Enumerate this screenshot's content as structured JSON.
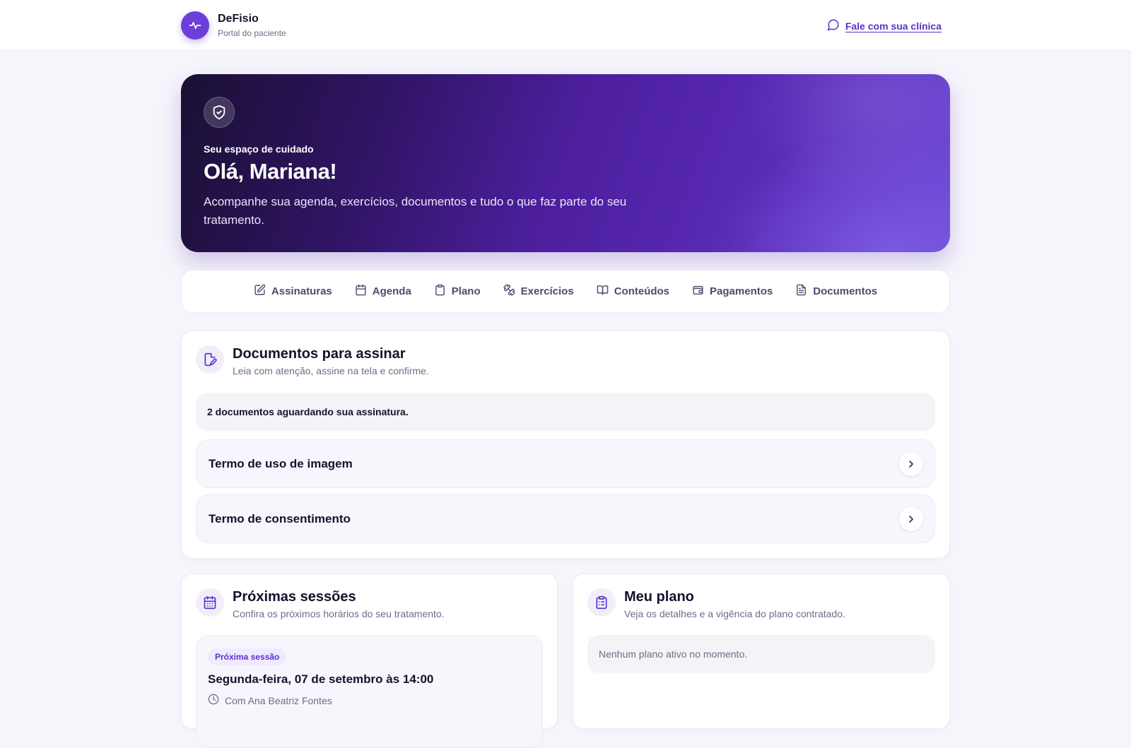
{
  "header": {
    "brand_name": "DeFisio",
    "brand_sub": "Portal do paciente",
    "contact_label": "Fale com sua clínica"
  },
  "hero": {
    "eyebrow": "Seu espaço de cuidado",
    "title": "Olá, Mariana!",
    "description": "Acompanhe sua agenda, exercícios, documentos e tudo o que faz parte do seu tratamento."
  },
  "tabs": [
    {
      "label": "Assinaturas",
      "icon": "signature-icon"
    },
    {
      "label": "Agenda",
      "icon": "calendar-icon"
    },
    {
      "label": "Plano",
      "icon": "clipboard-icon"
    },
    {
      "label": "Exercícios",
      "icon": "dumbbell-icon"
    },
    {
      "label": "Conteúdos",
      "icon": "book-icon"
    },
    {
      "label": "Pagamentos",
      "icon": "wallet-icon"
    },
    {
      "label": "Documentos",
      "icon": "file-icon"
    }
  ],
  "documents": {
    "title": "Documentos para assinar",
    "subtitle": "Leia com atenção, assine na tela e confirme.",
    "notice": "2 documentos aguardando sua assinatura.",
    "items": [
      {
        "name": "Termo de uso de imagem"
      },
      {
        "name": "Termo de consentimento"
      }
    ]
  },
  "sessions": {
    "title": "Próximas sessões",
    "subtitle": "Confira os próximos horários do seu tratamento.",
    "next_badge": "Próxima sessão",
    "next_datetime": "Segunda-feira, 07 de setembro às 14:00",
    "next_professional": "Com Ana Beatriz Fontes"
  },
  "plan": {
    "title": "Meu plano",
    "subtitle": "Veja os detalhes e a vigência do plano contratado.",
    "empty": "Nenhum plano ativo no momento."
  },
  "colors": {
    "accent": "#6b3fd8",
    "link": "#5b2fcf",
    "text": "#14122b",
    "muted": "#6f6c86",
    "page_bg": "#f6f5fb"
  }
}
